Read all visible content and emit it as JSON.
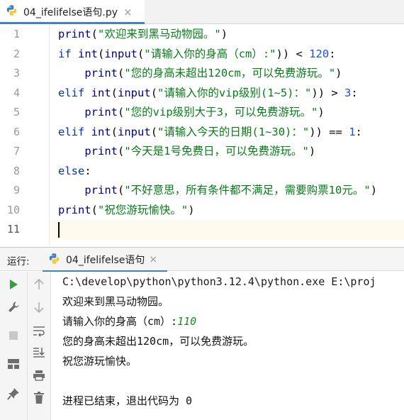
{
  "editor_tab": {
    "title": "04_ifelifelse语句.py",
    "close": "×"
  },
  "editor": {
    "line_numbers": [
      "1",
      "2",
      "3",
      "4",
      "5",
      "6",
      "7",
      "8",
      "9",
      "10",
      "11"
    ],
    "lines": [
      [
        {
          "t": "print",
          "c": "fn"
        },
        {
          "t": "(",
          "c": "op"
        },
        {
          "t": "\"欢迎来到黑马动物园。\"",
          "c": "str"
        },
        {
          "t": ")",
          "c": "op"
        }
      ],
      [
        {
          "t": "if ",
          "c": "kw"
        },
        {
          "t": "int",
          "c": "fn"
        },
        {
          "t": "(",
          "c": "op"
        },
        {
          "t": "input",
          "c": "fn"
        },
        {
          "t": "(",
          "c": "op"
        },
        {
          "t": "\"请输入你的身高（cm）:\"",
          "c": "str"
        },
        {
          "t": ")) < ",
          "c": "op"
        },
        {
          "t": "120",
          "c": "num"
        },
        {
          "t": ":",
          "c": "op"
        }
      ],
      [
        {
          "t": "    ",
          "c": "op"
        },
        {
          "t": "print",
          "c": "fn"
        },
        {
          "t": "(",
          "c": "op"
        },
        {
          "t": "\"您的身高未超出120cm，可以免费游玩。\"",
          "c": "str"
        },
        {
          "t": ")",
          "c": "op"
        }
      ],
      [
        {
          "t": "elif ",
          "c": "kw"
        },
        {
          "t": "int",
          "c": "fn"
        },
        {
          "t": "(",
          "c": "op"
        },
        {
          "t": "input",
          "c": "fn"
        },
        {
          "t": "(",
          "c": "op"
        },
        {
          "t": "\"请输入你的vip级别(1~5)：\"",
          "c": "str"
        },
        {
          "t": ")) > ",
          "c": "op"
        },
        {
          "t": "3",
          "c": "num"
        },
        {
          "t": ":",
          "c": "op"
        }
      ],
      [
        {
          "t": "    ",
          "c": "op"
        },
        {
          "t": "print",
          "c": "fn"
        },
        {
          "t": "(",
          "c": "op"
        },
        {
          "t": "\"您的vip级别大于3，可以免费游玩。\"",
          "c": "str"
        },
        {
          "t": ")",
          "c": "op"
        }
      ],
      [
        {
          "t": "elif ",
          "c": "kw"
        },
        {
          "t": "int",
          "c": "fn"
        },
        {
          "t": "(",
          "c": "op"
        },
        {
          "t": "input",
          "c": "fn"
        },
        {
          "t": "(",
          "c": "op"
        },
        {
          "t": "\"请输入今天的日期(1~30)：\"",
          "c": "str"
        },
        {
          "t": ")) == ",
          "c": "op"
        },
        {
          "t": "1",
          "c": "num"
        },
        {
          "t": ":",
          "c": "op"
        }
      ],
      [
        {
          "t": "    ",
          "c": "op"
        },
        {
          "t": "print",
          "c": "fn"
        },
        {
          "t": "(",
          "c": "op"
        },
        {
          "t": "\"今天是1号免费日，可以免费游玩。\"",
          "c": "str"
        },
        {
          "t": ")",
          "c": "op"
        }
      ],
      [
        {
          "t": "else",
          "c": "kw"
        },
        {
          "t": ":",
          "c": "op"
        }
      ],
      [
        {
          "t": "    ",
          "c": "op"
        },
        {
          "t": "print",
          "c": "fn"
        },
        {
          "t": "(",
          "c": "op"
        },
        {
          "t": "\"不好意思，所有条件都不满足，需要购票10元。\"",
          "c": "str"
        },
        {
          "t": ")",
          "c": "op"
        }
      ],
      [
        {
          "t": "print",
          "c": "fn"
        },
        {
          "t": "(",
          "c": "op"
        },
        {
          "t": "\"祝您游玩愉快。\"",
          "c": "str"
        },
        {
          "t": ")",
          "c": "op"
        }
      ],
      []
    ]
  },
  "run_panel": {
    "label": "运行:",
    "tab_title": "04_ifelifelse语句",
    "tab_close": "×",
    "console": {
      "command": "C:\\develop\\python\\python3.12.4\\python.exe E:\\proj",
      "welcome": "欢迎来到黑马动物园。",
      "prompt": "请输入你的身高（cm）:",
      "user_input": "110",
      "result": "您的身高未超出120cm，可以免费游玩。",
      "bye": "祝您游玩愉快。",
      "exit": "进程已结束，退出代码为 0"
    }
  },
  "colors": {
    "accent": "#4083c9",
    "keyword": "#0033b3",
    "string": "#067d17",
    "number": "#1750eb",
    "run_green": "#3e9b3e"
  }
}
